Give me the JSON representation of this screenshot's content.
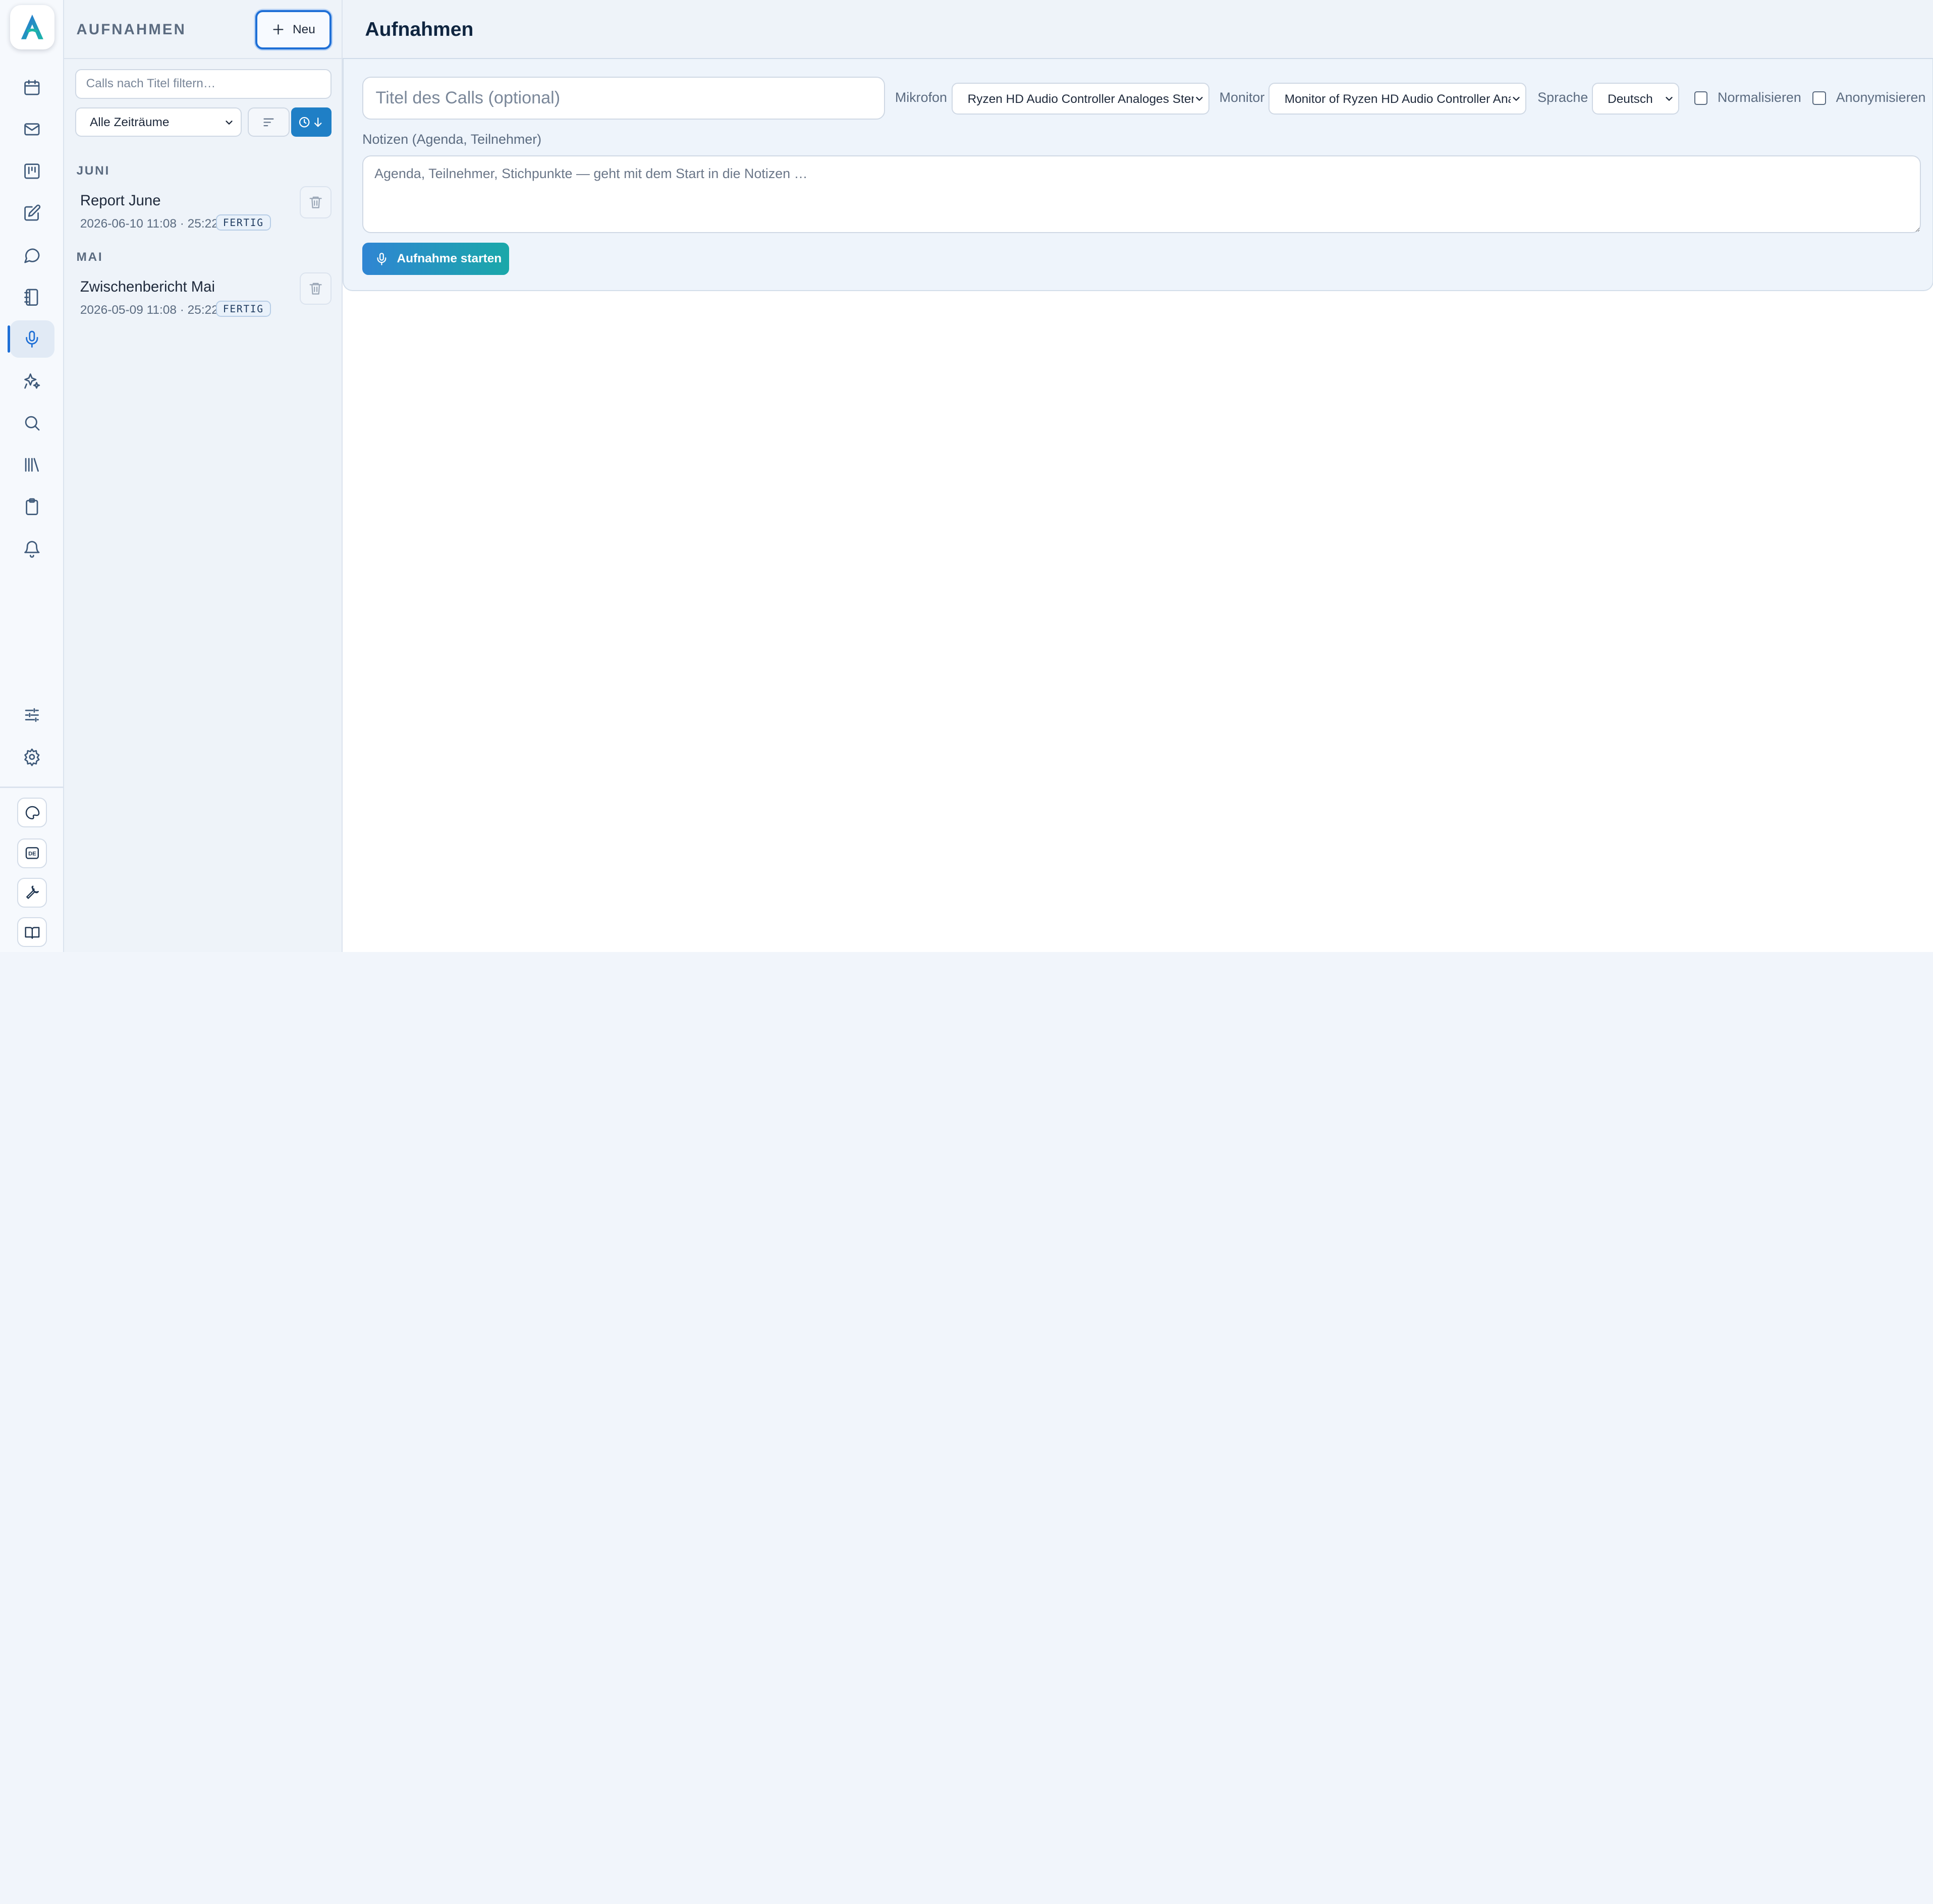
{
  "rail": {
    "logo_icon": "app-logo-a",
    "nav_icons": [
      "calendar-icon",
      "mail-icon",
      "board-icon",
      "edit-icon",
      "chat-icon",
      "notebook-icon",
      "microphone-icon",
      "sparkles-icon",
      "search-icon",
      "library-icon",
      "clipboard-icon",
      "bell-icon"
    ],
    "active_item": "microphone-icon",
    "bottom_icons": [
      "sliders-icon",
      "gear-icon"
    ],
    "tool_icons": [
      "palette-icon",
      "de-language-icon",
      "wrench-icon",
      "book-icon"
    ],
    "de_label": "DE"
  },
  "sidebar": {
    "title": "AUFNAHMEN",
    "new_button": "Neu",
    "filter_placeholder": "Calls nach Titel filtern…",
    "period_select": "Alle Zeiträume",
    "groups": [
      {
        "month": "JUNI",
        "items": [
          {
            "title": "Report June",
            "meta": "2026-06-10 11:08 · 25:22",
            "status": "FERTIG"
          }
        ]
      },
      {
        "month": "MAI",
        "items": [
          {
            "title": "Zwischenbericht Mai",
            "meta": "2026-05-09 11:08 · 25:22",
            "status": "FERTIG"
          }
        ]
      }
    ]
  },
  "main": {
    "title": "Aufnahmen",
    "call_title_placeholder": "Titel des Calls (optional)",
    "microphone_label": "Mikrofon",
    "microphone_value": "Ryzen HD Audio Controller Analoges Stereo",
    "monitor_label": "Monitor",
    "monitor_value": "Monitor of Ryzen HD Audio Controller Analoges Stereo",
    "language_label": "Sprache",
    "language_value": "Deutsch",
    "normalize_label": "Normalisieren",
    "anonymize_label": "Anonymisieren",
    "notes_label": "Notizen (Agenda, Teilnehmer)",
    "notes_placeholder": "Agenda, Teilnehmer, Stichpunkte — geht mit dem Start in die Notizen …",
    "start_button": "Aufnahme starten"
  },
  "colors": {
    "accent": "#1e6fd6",
    "start_gradient_from": "#2f85d3",
    "start_gradient_to": "#1aa8a9",
    "badge_bg": "#e9f1fa"
  }
}
